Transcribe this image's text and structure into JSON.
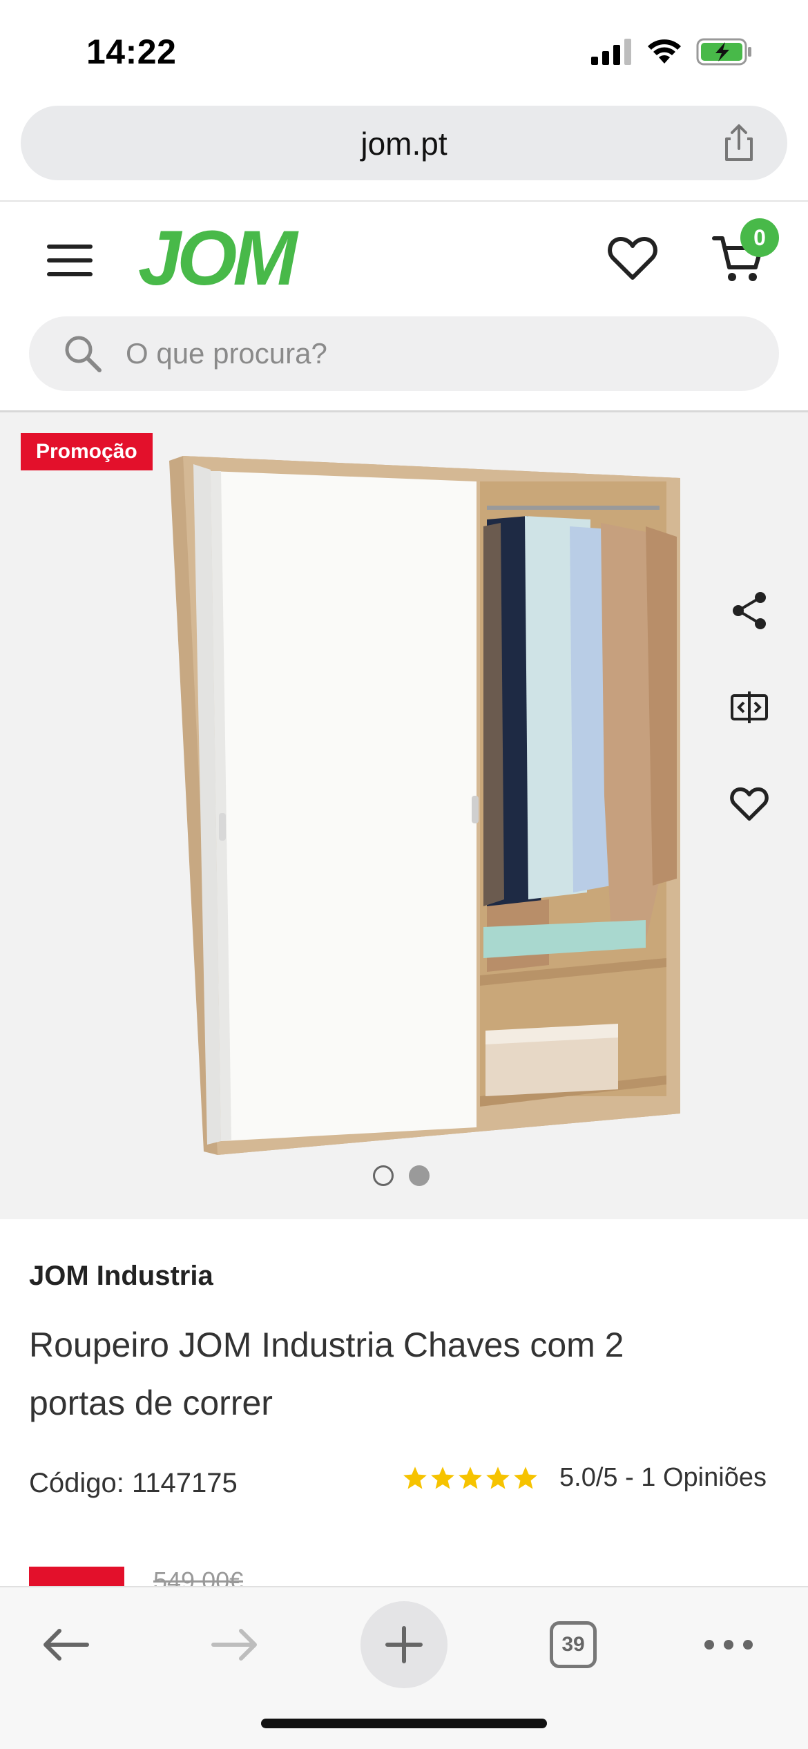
{
  "status_bar": {
    "time": "14:22"
  },
  "browser": {
    "url": "jom.pt",
    "tabs_count": "39"
  },
  "header": {
    "logo": "JOM",
    "cart_count": "0",
    "search_placeholder": "O que procura?"
  },
  "gallery": {
    "promo_label": "Promoção",
    "active_dot": 2,
    "dot_count": 2
  },
  "product": {
    "brand": "JOM Industria",
    "title": "Roupeiro JOM Industria Chaves com 2 portas de correr",
    "code": "Código: 1147175",
    "rating_text": "5.0/5 - 1 Opiniões",
    "stars": 5,
    "old_price": "549,00€"
  },
  "colors": {
    "brand_green": "#48b949",
    "promo_red": "#e3102b",
    "star_yellow": "#f6c300"
  },
  "icons": [
    "signal-icon",
    "wifi-icon",
    "battery-icon",
    "share-icon",
    "menu-icon",
    "heart-icon",
    "cart-icon",
    "search-icon",
    "compare-icon",
    "back-icon",
    "forward-icon",
    "plus-icon",
    "more-icon"
  ]
}
